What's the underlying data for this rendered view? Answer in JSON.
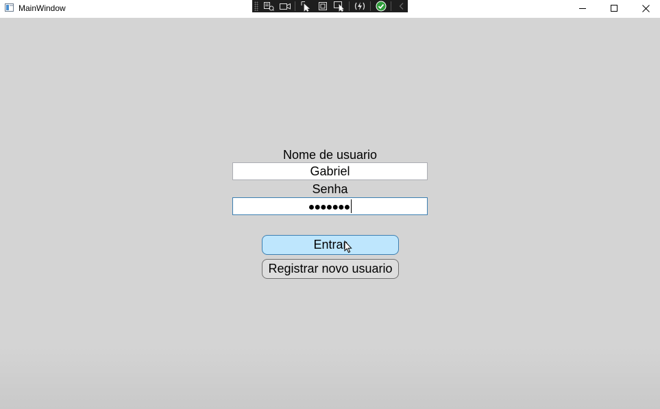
{
  "window": {
    "title": "MainWindow"
  },
  "login": {
    "username_label": "Nome de usuario",
    "username_value": "Gabriel",
    "password_label": "Senha",
    "password_value": "●●●●●●●",
    "enter_button": "Entrar",
    "register_button": "Registrar novo usuario"
  },
  "colors": {
    "background": "#d4d4d4",
    "enter_button_bg": "#bee6fd",
    "enter_button_border": "#3c7fb1",
    "register_button_bg": "#dddddd",
    "debug_toolbar_bg": "#1e1e1e"
  },
  "icons": {
    "window_controls": [
      "minimize-icon",
      "maximize-icon",
      "close-icon"
    ],
    "debug_toolbar": [
      "grip-icon",
      "live-tree-icon",
      "record-icon",
      "select-element-icon",
      "layout-adorners-icon",
      "track-focus-icon",
      "hot-reload-icon",
      "check-icon",
      "collapse-arrow-icon"
    ]
  }
}
